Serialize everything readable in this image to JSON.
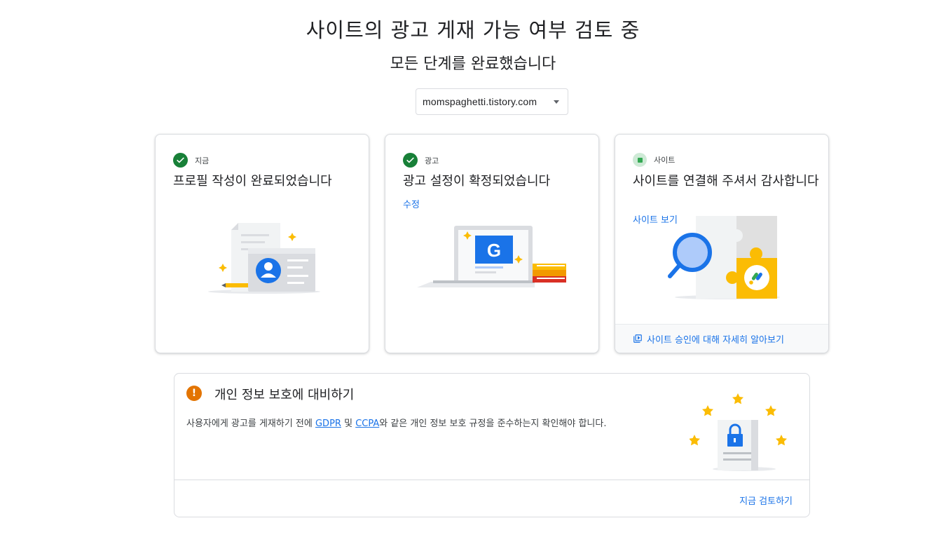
{
  "header": {
    "title": "사이트의 광고 게재 가능 여부 검토 중",
    "subtitle": "모든 단계를 완료했습니다"
  },
  "site_select": {
    "value": "momspaghetti.tistory.com"
  },
  "cards": [
    {
      "step_label": "지금",
      "title": "프로필 작성이 완료되었습니다",
      "status": "complete"
    },
    {
      "step_label": "광고",
      "title": "광고 설정이 확정되었습니다",
      "link": "수정",
      "status": "complete"
    },
    {
      "step_label": "사이트",
      "title": "사이트를 연결해 주셔서 감사합니다",
      "link": "사이트 보기",
      "footer_link": "사이트 승인에 대해 자세히 알아보기",
      "status": "in-review"
    }
  ],
  "privacy": {
    "title": "개인 정보 보호에 대비하기",
    "body_prefix": "사용자에게 광고를 게재하기 전에 ",
    "gdpr": "GDPR",
    "and": " 및 ",
    "ccpa": "CCPA",
    "body_suffix": "와 같은 개인 정보 보호 규정을 준수하는지 확인해야 합니다.",
    "review_button": "지금 검토하기"
  },
  "colors": {
    "accent": "#1a73e8",
    "success": "#188038",
    "warning": "#e37400",
    "star": "#fbbc04"
  }
}
